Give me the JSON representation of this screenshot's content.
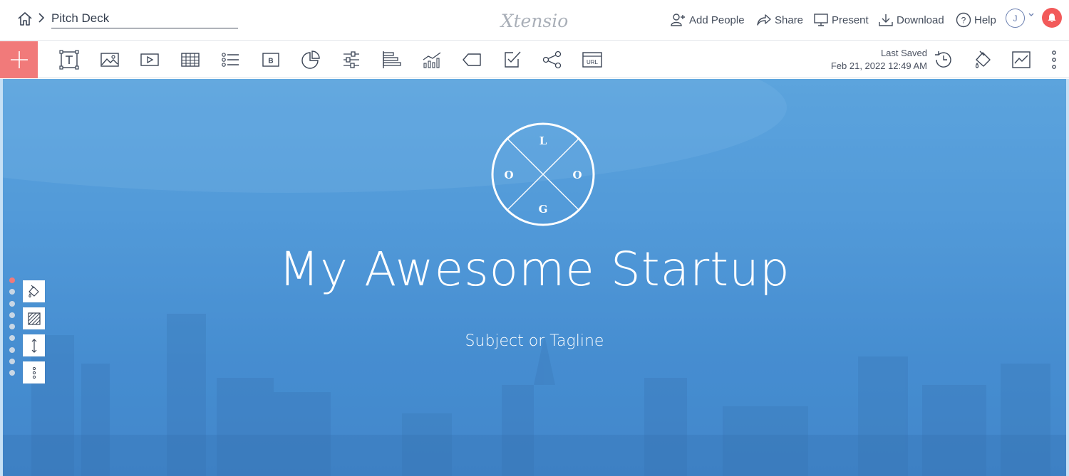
{
  "header": {
    "doc_title": "Pitch Deck",
    "brand": "Xtensio",
    "actions": [
      {
        "label": "Add People",
        "icon": "add-person-icon"
      },
      {
        "label": "Share",
        "icon": "share-arrow-icon"
      },
      {
        "label": "Present",
        "icon": "presentation-screen-icon"
      },
      {
        "label": "Download",
        "icon": "download-icon"
      },
      {
        "label": "Help",
        "icon": "help-circle-icon"
      }
    ],
    "avatar_initial": "J"
  },
  "toolbar": {
    "tools": [
      {
        "name": "text-tool",
        "icon": "text-box-icon"
      },
      {
        "name": "image-tool",
        "icon": "image-icon"
      },
      {
        "name": "video-tool",
        "icon": "video-play-icon"
      },
      {
        "name": "table-tool",
        "icon": "table-icon"
      },
      {
        "name": "list-tool",
        "icon": "list-icon"
      },
      {
        "name": "button-tool",
        "icon": "button-b-icon",
        "label": "B"
      },
      {
        "name": "pie-chart-tool",
        "icon": "pie-chart-icon"
      },
      {
        "name": "slider-tool",
        "icon": "sliders-icon"
      },
      {
        "name": "bar-chart-tool",
        "icon": "horizontal-bars-icon"
      },
      {
        "name": "line-chart-tool",
        "icon": "line-bar-chart-icon"
      },
      {
        "name": "tag-tool",
        "icon": "tag-icon"
      },
      {
        "name": "checkbox-tool",
        "icon": "checkbox-pen-icon"
      },
      {
        "name": "connections-tool",
        "icon": "share-nodes-icon"
      },
      {
        "name": "url-tool",
        "icon": "url-icon",
        "label": "URL"
      }
    ],
    "last_saved_label": "Last Saved",
    "last_saved_time": "Feb 21, 2022 12:49 AM",
    "right_icons": [
      "history-icon",
      "paint-bucket-icon",
      "analytics-icon",
      "more-vertical-icon"
    ]
  },
  "slide": {
    "logo_letters": {
      "top": "L",
      "left": "O",
      "right": "O",
      "bottom": "G"
    },
    "title": "My Awesome Startup",
    "tagline": "Subject or Tagline",
    "page_dot_count": 10,
    "active_dot": 0,
    "side_tools": [
      "paint-bucket-icon",
      "pattern-icon",
      "resize-vertical-icon",
      "more-vertical-icon"
    ]
  },
  "colors": {
    "accent": "#f17a7a",
    "notification": "#f25a5a",
    "slide_background": "#4f97d8",
    "text_dark": "#3b4556"
  }
}
